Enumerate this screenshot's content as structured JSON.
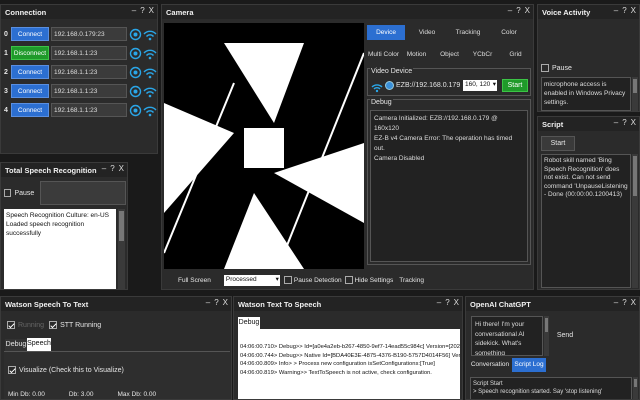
{
  "connection": {
    "title": "Connection",
    "rows": [
      {
        "index": "0",
        "button": "Connect",
        "address": "192.168.0.179:23",
        "state": "connect"
      },
      {
        "index": "1",
        "button": "Disconnect",
        "address": "192.168.1.1:23",
        "state": "disconnect"
      },
      {
        "index": "2",
        "button": "Connect",
        "address": "192.168.1.1:23",
        "state": "connect"
      },
      {
        "index": "3",
        "button": "Connect",
        "address": "192.168.1.1:23",
        "state": "connect"
      },
      {
        "index": "4",
        "button": "Connect",
        "address": "192.168.1.1:23",
        "state": "connect"
      }
    ]
  },
  "total_speech": {
    "title": "Total Speech Recognition",
    "pause_label": "Pause",
    "log": "Speech Recognition Culture: en-US\nLoaded speech recognition successfully"
  },
  "camera": {
    "title": "Camera",
    "tabs_row1": [
      "Device",
      "Video",
      "Tracking",
      "Color"
    ],
    "tabs_row2": [
      "Multi Color",
      "Motion",
      "Object",
      "YCbCr",
      "Grid"
    ],
    "active_tab": "Device",
    "video_device_label": "Video Device",
    "device_value": "EZB://192.168.0.179",
    "resolution_value": "160, 120",
    "start_label": "Start",
    "debug_label": "Debug",
    "debug_text": "Camera Initialized: EZB://192.168.0.179 @ 160x120\nEZ-B v4 Camera Error: The operation has timed out.\nCamera Disabled",
    "full_screen_label": "Full Screen",
    "mode_value": "Processed",
    "pause_detection_label": "Pause Detection",
    "hide_settings_label": "Hide Settings",
    "tracking_label": "Tracking"
  },
  "voice_activity": {
    "title": "Voice Activity",
    "pause_label": "Pause",
    "message": "microphone access is enabled in Windows Privacy settings."
  },
  "script": {
    "title": "Script",
    "start_label": "Start",
    "log": "Robot skill named 'Bing Speech Recognition' does not exist. Can not send command 'UnpauseListening - Done (00:00:00.1200413)"
  },
  "watson_stt": {
    "title": "Watson Speech To Text",
    "running_label": "Running",
    "stt_running_label": "STT Running",
    "tabs": [
      "Debug",
      "Speech"
    ],
    "active_tab": "Speech",
    "visualize_label": "Visualize (Check this to Visualize)",
    "min_db": "Min Db: 0.00",
    "db": "Db: 3.00",
    "max_db": "Max Db: 0.00"
  },
  "watson_tts": {
    "title": "Watson Text To Speech",
    "tab": "Debug",
    "log_lines": [
      "04:06:00.710> Debug>> Id=[a0e4a2eb-b267-4850-9ef7-14ead55c984c] Version=[2020",
      "04:06:00.744> Debug>> Native Id=[BDA40E3E-4875-4376-B190-5757D4014F56] Versi",
      "04:06:00.809> Info> > Process new configuration isSetConfigurations:[True]",
      "04:06:00.819> Warning>> TextToSpeech is not active, check configuration."
    ]
  },
  "openai": {
    "title": "OpenAI ChatGPT",
    "reply": "Hi there! I'm your conversational AI sidekick. What's something",
    "send_label": "Send",
    "tabs": [
      "Conversation",
      "Script Log"
    ],
    "active_tab": "Script Log",
    "log": "Script Start\n> Speech recognition started. Say 'stop listening'"
  },
  "window_controls": {
    "min": "–",
    "help": "?",
    "close": "X"
  },
  "colors": {
    "accent": "#2c6fd1",
    "start_green": "#1f9a2a",
    "disconnect": "#1f9a2a",
    "wifi": "#2aa6e8"
  }
}
